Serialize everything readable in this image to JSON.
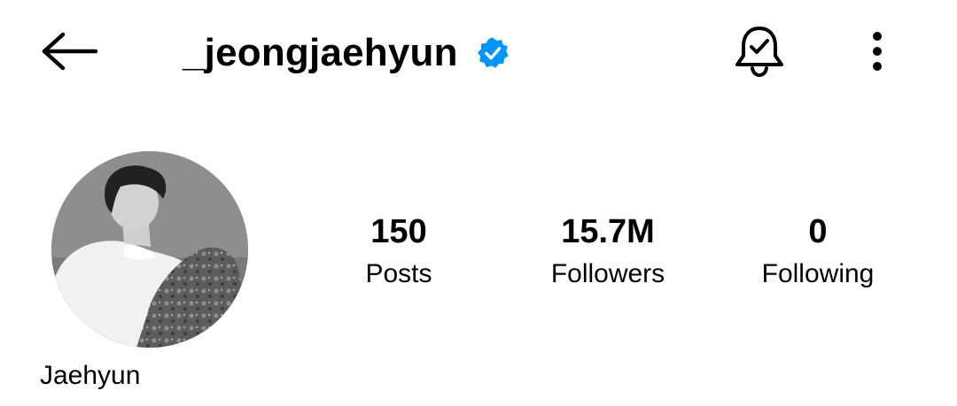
{
  "header": {
    "username": "_jeongjaehyun",
    "back_icon": "arrow-left-icon",
    "verified_icon": "verified-badge-icon",
    "notification_icon": "bell-check-icon",
    "more_icon": "vertical-dots-icon",
    "verified_color": "#0095f6"
  },
  "profile": {
    "display_name": "Jaehyun",
    "avatar_icon": "profile-photo"
  },
  "stats": [
    {
      "value": "150",
      "label": "Posts"
    },
    {
      "value": "15.7M",
      "label": "Followers"
    },
    {
      "value": "0",
      "label": "Following"
    }
  ]
}
